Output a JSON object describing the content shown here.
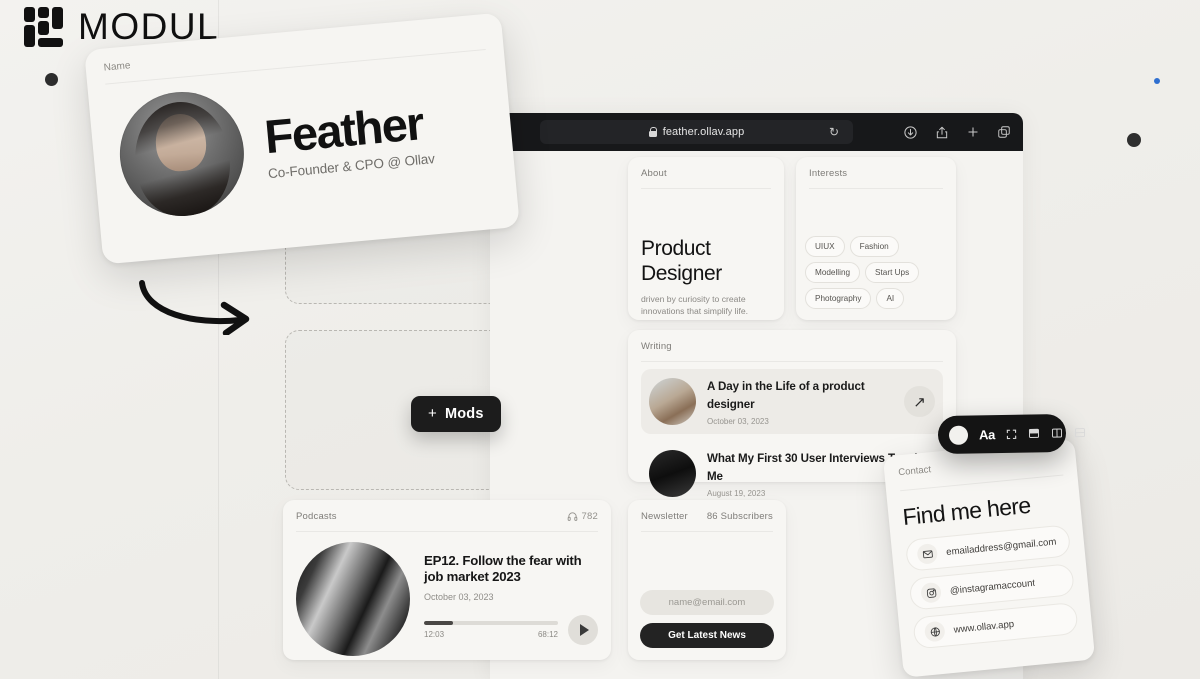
{
  "brand": {
    "name": "MODUL",
    "logo_icon": "modul-grid-logo"
  },
  "canvas": {
    "mods_button": {
      "label": "Mods",
      "plus": "+"
    },
    "dropzones": [
      "dropzone-top",
      "dropzone-main",
      "dropzone-right"
    ],
    "arrow_icon": "curved-arrow-right-icon",
    "accent_blue": "#2f6fd0",
    "dark": "#1c1c1c"
  },
  "browser": {
    "url": "feather.ollav.app",
    "lock_icon": "lock-icon",
    "reload_icon": "reload-icon",
    "actions": [
      {
        "name": "download-icon"
      },
      {
        "name": "share-icon"
      },
      {
        "name": "new-tab-icon"
      },
      {
        "name": "tabs-icon"
      }
    ]
  },
  "name_card": {
    "label": "Name",
    "name": "Feather",
    "role": "Co-Founder & CPO @ Ollav",
    "avatar_icon": "profile-photo"
  },
  "about": {
    "label": "About",
    "title": "Product Designer",
    "subtitle": "driven by curiosity to create innovations that simplify life."
  },
  "interests": {
    "label": "Interests",
    "tags": [
      "UIUX",
      "Fashion",
      "Modelling",
      "Start Ups",
      "Photography",
      "AI"
    ]
  },
  "writing": {
    "label": "Writing",
    "items": [
      {
        "title": "A Day in the Life of a product designer",
        "date": "October 03, 2023",
        "action_icon": "arrow-up-right-icon"
      },
      {
        "title": "What My First 30 User Interviews Taught Me",
        "date": "August 19, 2023"
      }
    ]
  },
  "podcasts": {
    "label": "Podcasts",
    "listens": "782",
    "listens_icon": "headphones-icon",
    "episode": {
      "title": "EP12. Follow the fear with job market 2023",
      "date": "October 03, 2023",
      "current_time": "12:03",
      "total_time": "68:12",
      "progress_percent": 22,
      "play_icon": "play-icon"
    }
  },
  "newsletter": {
    "label": "Newsletter",
    "subscribers": "86 Subscribers",
    "email_placeholder": "name@email.com",
    "email_value": "",
    "cta_label": "Get Latest News"
  },
  "contact": {
    "label": "Contact",
    "title": "Find me here",
    "rows": [
      {
        "icon": "mail-icon",
        "value": "emailaddress@gmail.com"
      },
      {
        "icon": "instagram-icon",
        "value": "@instagramaccount"
      },
      {
        "icon": "globe-icon",
        "value": "www.ollav.app"
      }
    ]
  },
  "toolbar": {
    "swatch_icon": "color-swatch-icon",
    "text_label": "Aa",
    "items": [
      {
        "icon": "expand-icon"
      },
      {
        "icon": "layout-stack-icon"
      },
      {
        "icon": "layout-columns-icon"
      },
      {
        "icon": "layout-rows-icon"
      }
    ]
  }
}
